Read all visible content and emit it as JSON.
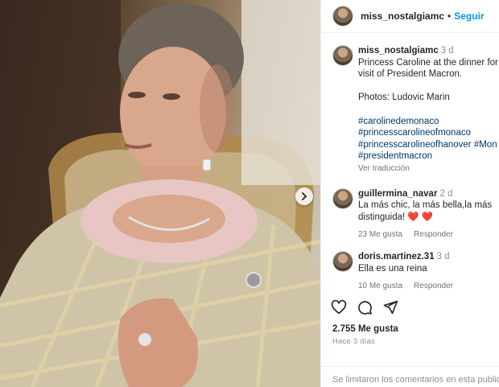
{
  "post": {
    "username": "miss_nostalgiamc",
    "follow_label": "Seguir",
    "separator": "•"
  },
  "caption": {
    "username": "miss_nostalgiamc",
    "age": "3 d",
    "lines": [
      "Princess Caroline at the dinner for",
      "visit of President Macron."
    ],
    "credit": "Photos: Ludovic Marin",
    "hashtags": [
      "#carolinedemonaco",
      "#princesscarolineofmonaco",
      "#princesscarolineofhanover #Mon",
      "#presidentmacron"
    ],
    "translate_label": "Ver traducción"
  },
  "comments": [
    {
      "username": "guillermina_navar",
      "age": "2 d",
      "lines": [
        "La más chic, la más bella,la más",
        "distinguida!"
      ],
      "emoji": "❤️ ❤️",
      "likes": "23 Me gusta",
      "reply_label": "Responder"
    },
    {
      "username": "doris.martinez.31",
      "age": "3 d",
      "lines": [
        "Ella es una reina"
      ],
      "likes": "10 Me gusta",
      "reply_label": "Responder"
    }
  ],
  "actions": {
    "icons": [
      "heart-icon",
      "comment-icon",
      "share-icon"
    ]
  },
  "stats": {
    "likes": "2.755 Me gusta",
    "time_ago": "Hace 3 días"
  },
  "footer": {
    "limited_text": "Se limitaron los comentarios en esta publicación"
  },
  "colors": {
    "link": "#0095f6",
    "hashtag": "#00376b",
    "muted": "#8e8e8e",
    "heart": "#ed4956"
  }
}
